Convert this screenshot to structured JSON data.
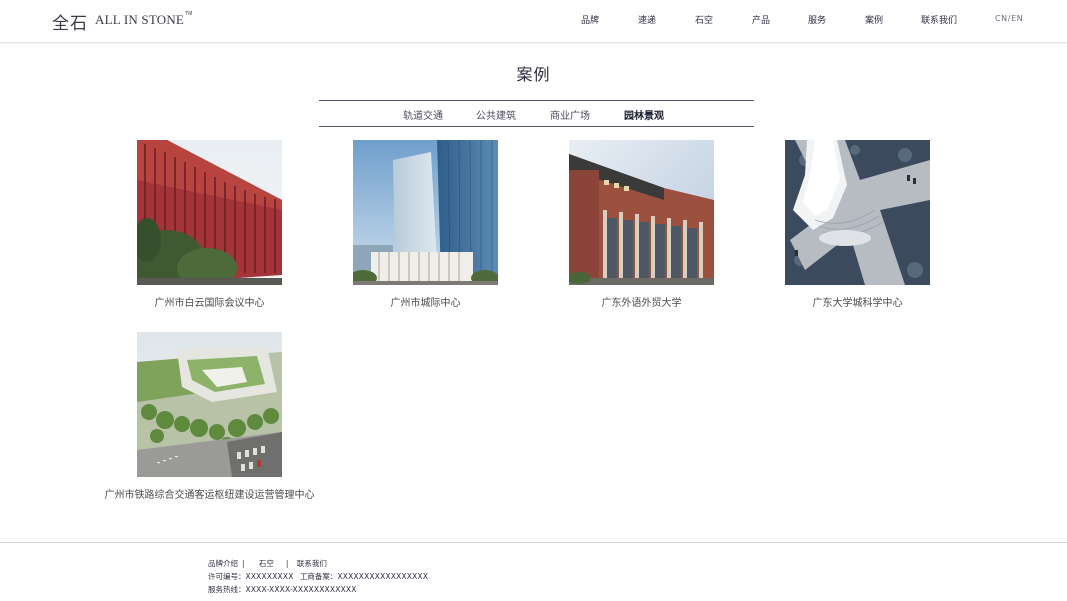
{
  "brand": {
    "cn": "全石",
    "en": "ALL IN STONE",
    "tm": "TM"
  },
  "nav": {
    "items": [
      "品牌",
      "速递",
      "石空",
      "产品",
      "服务",
      "案例",
      "联系我们"
    ],
    "lang": "CN/EN"
  },
  "page": {
    "title": "案例"
  },
  "tabs": {
    "items": [
      "轨道交通",
      "公共建筑",
      "商业广场",
      "园林景观"
    ],
    "active": "园林景观"
  },
  "cases": [
    {
      "name": "广州市白云国际会议中心",
      "image": "red-facade-building"
    },
    {
      "name": "广州市城际中心",
      "image": "glass-towers"
    },
    {
      "name": "广东外语外贸大学",
      "image": "university-building"
    },
    {
      "name": "广东大学城科学中心",
      "image": "science-center-aerial"
    },
    {
      "name": "广州市铁路综合交通客运枢纽建设运营管理中心",
      "image": "green-roof-complex-aerial"
    }
  ],
  "footer": {
    "links": [
      "品牌介绍",
      "石空",
      "联系我们"
    ],
    "license_label": "许可编号：",
    "license_value": "XXXXXXXXX",
    "icp_label": "工商备案：",
    "icp_value": "XXXXXXXXXXXXXXXXX",
    "hotline_label": "服务热线：",
    "hotline_value": "XXXX-XXXX-XXXXXXXXXXXX"
  }
}
